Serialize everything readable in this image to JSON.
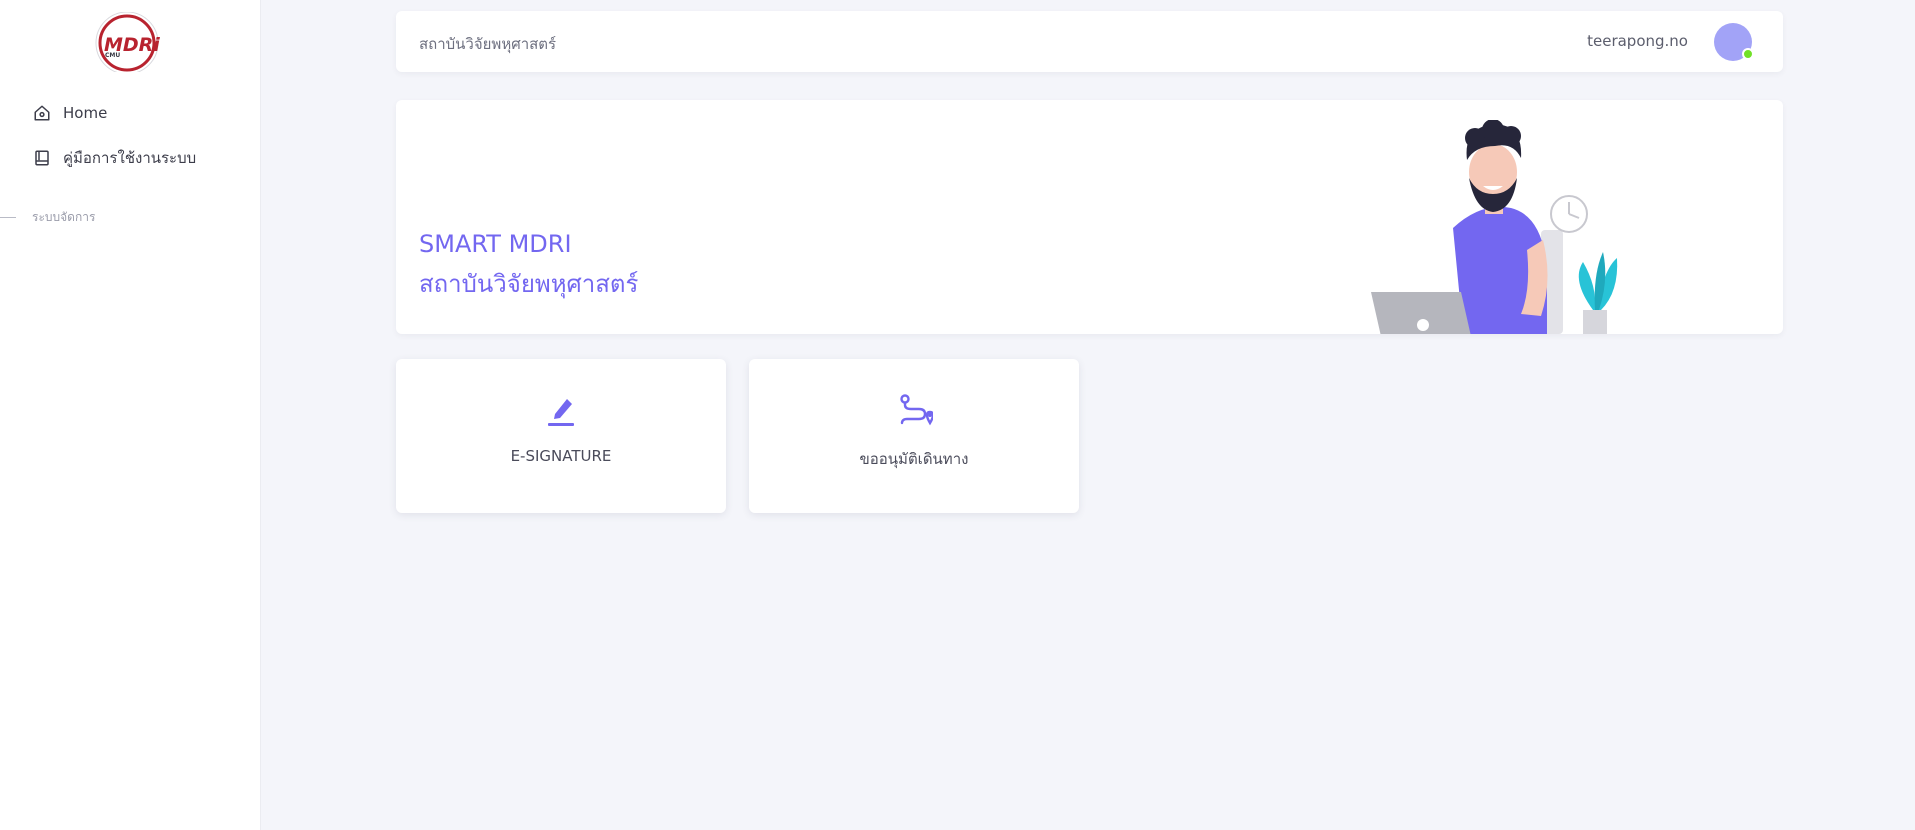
{
  "sidebar": {
    "logo_text": "MDRi",
    "logo_sub": "CMU",
    "items": [
      {
        "label": "Home",
        "icon": "home-icon"
      },
      {
        "label": "คู่มือการใช้งานระบบ",
        "icon": "book-icon"
      }
    ],
    "section_label": "ระบบจัดการ"
  },
  "header": {
    "breadcrumb": "สถาบันวิจัยพหุศาสตร์",
    "username": "teerapong.no",
    "status": "online"
  },
  "hero": {
    "title_line1": "SMART MDRI",
    "title_line2": "สถาบันวิจัยพหุศาสตร์"
  },
  "cards": [
    {
      "label": "E-SIGNATURE",
      "icon": "pen-icon"
    },
    {
      "label": "ขออนุมัติเดินทาง",
      "icon": "route-icon"
    }
  ],
  "colors": {
    "accent": "#7367f0",
    "avatar": "#a2a3f7",
    "status_online": "#72e128",
    "logo_red": "#b8232f"
  }
}
